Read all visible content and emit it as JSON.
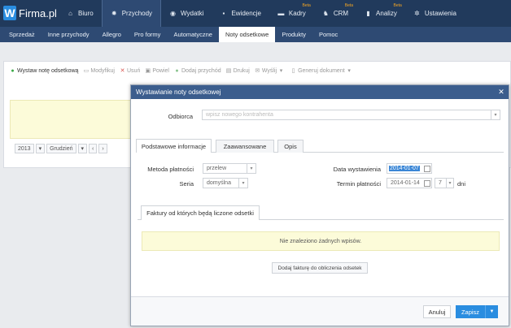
{
  "brand": {
    "letter": "W",
    "name": "Firma.pl"
  },
  "topnav": [
    {
      "label": "Biuro",
      "icon": "home-icon",
      "glyph": "⌂",
      "active": false,
      "beta": ""
    },
    {
      "label": "Przychody",
      "icon": "gear-icon",
      "glyph": "✹",
      "active": true,
      "beta": ""
    },
    {
      "label": "Wydatki",
      "icon": "minus-circle-icon",
      "glyph": "◉",
      "active": false,
      "beta": ""
    },
    {
      "label": "Ewidencje",
      "icon": "book-icon",
      "glyph": "▪",
      "active": false,
      "beta": ""
    },
    {
      "label": "Kadry",
      "icon": "folder-icon",
      "glyph": "▬",
      "active": false,
      "beta": "Beta"
    },
    {
      "label": "CRM",
      "icon": "users-icon",
      "glyph": "♞",
      "active": false,
      "beta": "Beta"
    },
    {
      "label": "Analizy",
      "icon": "bar-chart-icon",
      "glyph": "▮",
      "active": false,
      "beta": "Beta"
    },
    {
      "label": "Ustawienia",
      "icon": "cog-icon",
      "glyph": "✲",
      "active": false,
      "beta": ""
    }
  ],
  "subnav": [
    {
      "label": "Sprzedaż",
      "active": false
    },
    {
      "label": "Inne przychody",
      "active": false
    },
    {
      "label": "Allegro",
      "active": false
    },
    {
      "label": "Pro formy",
      "active": false
    },
    {
      "label": "Automatyczne",
      "active": false
    },
    {
      "label": "Noty odsetkowe",
      "active": true
    },
    {
      "label": "Produkty",
      "active": false
    },
    {
      "label": "Pomoc",
      "active": false
    }
  ],
  "toolbar": {
    "issue": "Wystaw notę odsetkową",
    "modify": "Modyfikuj",
    "delete": "Usuń",
    "repeat": "Powiel",
    "add_income": "Dodaj przychód",
    "print": "Drukuj",
    "send": "Wyślij",
    "generate": "Generuj dokument"
  },
  "datebar": {
    "year": "2013",
    "month": "Grudzień"
  },
  "modal": {
    "title": "Wystawianie noty odsetkowej",
    "recipient_label": "Odbiorca",
    "recipient_placeholder": "wpisz nowego kontrahenta",
    "tabs": [
      "Podstawowe informacje",
      "Zaawansowane",
      "Opis"
    ],
    "payment_method_label": "Metoda płatności",
    "payment_method_value": "przelew",
    "series_label": "Seria",
    "series_value": "domyślna",
    "issue_date_label": "Data wystawienia",
    "issue_date_value": "2014-01-07",
    "payment_term_label": "Termin płatności",
    "payment_term_value": "2014-01-14",
    "payment_days_value": "7",
    "days_unit": "dni",
    "invoices_tab": "Faktury od których będą liczone odsetki",
    "empty_message": "Nie znaleziono żadnych wpisów.",
    "add_invoice": "Dodaj fakturę do obliczenia odsetek",
    "cancel": "Anuluj",
    "save": "Zapisz"
  }
}
